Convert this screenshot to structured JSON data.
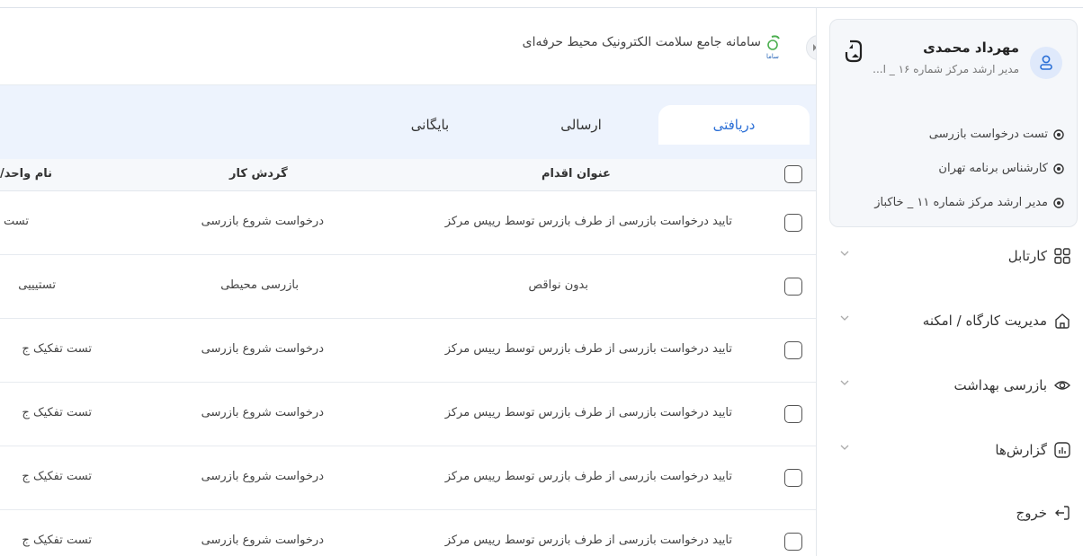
{
  "header": {
    "app_title": "سامانه جامع سلامت الکترونیک محیط حرفه‌ای",
    "logo_label": "ساما"
  },
  "tabs": [
    {
      "label": "دریافتی",
      "active": true
    },
    {
      "label": "ارسالی",
      "active": false
    },
    {
      "label": "بایگانی",
      "active": false
    }
  ],
  "table": {
    "columns": [
      "عنوان اقدام",
      "گردش کار",
      "نام واحد/"
    ],
    "rows": [
      {
        "action": "تایید درخواست بازرسی از طرف بازرس توسط رییس مرکز",
        "workflow": "درخواست شروع بازرسی",
        "unit": "تست"
      },
      {
        "action": "بدون نواقص",
        "workflow": "بازرسی محیطی",
        "unit": "تستیییی"
      },
      {
        "action": "تایید درخواست بازرسی از طرف بازرس توسط رییس مرکز",
        "workflow": "درخواست شروع بازرسی",
        "unit": "تست تفکیک ج"
      },
      {
        "action": "تایید درخواست بازرسی از طرف بازرس توسط رییس مرکز",
        "workflow": "درخواست شروع بازرسی",
        "unit": "تست تفکیک ج"
      },
      {
        "action": "تایید درخواست بازرسی از طرف بازرس توسط رییس مرکز",
        "workflow": "درخواست شروع بازرسی",
        "unit": "تست تفکیک ج"
      },
      {
        "action": "تایید درخواست بازرسی از طرف بازرس توسط رییس مرکز",
        "workflow": "درخواست شروع بازرسی",
        "unit": "تست تفکیک ج"
      }
    ]
  },
  "profile": {
    "name": "مهرداد محمدی",
    "role": "مدیر ارشد مرکز شماره ۱۶ _ ا...",
    "roles": [
      "تست درخواست بازرسی",
      "کارشناس برنامه تهران",
      "مدیر ارشد مرکز شماره ۱۱ _ خاکباز"
    ]
  },
  "nav": {
    "items": [
      {
        "label": "کارتابل",
        "icon": "grid-icon"
      },
      {
        "label": "مدیریت کارگاه / امکنه",
        "icon": "home-icon"
      },
      {
        "label": "بازرسی بهداشت",
        "icon": "eye-icon"
      },
      {
        "label": "گزارش‌ها",
        "icon": "chart-icon"
      }
    ],
    "logout": "خروج"
  },
  "colors": {
    "accent": "#2b6fd6",
    "tabbar_bg": "#edf3fd",
    "card_bg": "#f5f7fa"
  }
}
